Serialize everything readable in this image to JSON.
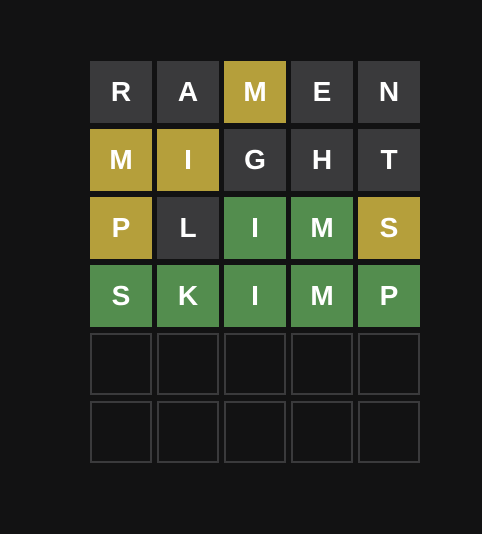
{
  "game": {
    "colors": {
      "background": "#121213",
      "absent": "#3a3a3c",
      "present": "#b59f3b",
      "correct": "#538d4e",
      "empty_border": "#3a3a3c",
      "letter": "#ffffff"
    },
    "rows": [
      {
        "word": "RAMEN",
        "tiles": [
          {
            "letter": "R",
            "state": "absent"
          },
          {
            "letter": "A",
            "state": "absent"
          },
          {
            "letter": "M",
            "state": "present"
          },
          {
            "letter": "E",
            "state": "absent"
          },
          {
            "letter": "N",
            "state": "absent"
          }
        ]
      },
      {
        "word": "MIGHT",
        "tiles": [
          {
            "letter": "M",
            "state": "present"
          },
          {
            "letter": "I",
            "state": "present"
          },
          {
            "letter": "G",
            "state": "absent"
          },
          {
            "letter": "H",
            "state": "absent"
          },
          {
            "letter": "T",
            "state": "absent"
          }
        ]
      },
      {
        "word": "PLIMS",
        "tiles": [
          {
            "letter": "P",
            "state": "present"
          },
          {
            "letter": "L",
            "state": "absent"
          },
          {
            "letter": "I",
            "state": "correct"
          },
          {
            "letter": "M",
            "state": "correct"
          },
          {
            "letter": "S",
            "state": "present"
          }
        ]
      },
      {
        "word": "SKIMP",
        "tiles": [
          {
            "letter": "S",
            "state": "correct"
          },
          {
            "letter": "K",
            "state": "correct"
          },
          {
            "letter": "I",
            "state": "correct"
          },
          {
            "letter": "M",
            "state": "correct"
          },
          {
            "letter": "P",
            "state": "correct"
          }
        ]
      },
      {
        "word": "",
        "tiles": [
          {
            "letter": "",
            "state": "empty"
          },
          {
            "letter": "",
            "state": "empty"
          },
          {
            "letter": "",
            "state": "empty"
          },
          {
            "letter": "",
            "state": "empty"
          },
          {
            "letter": "",
            "state": "empty"
          }
        ]
      },
      {
        "word": "",
        "tiles": [
          {
            "letter": "",
            "state": "empty"
          },
          {
            "letter": "",
            "state": "empty"
          },
          {
            "letter": "",
            "state": "empty"
          },
          {
            "letter": "",
            "state": "empty"
          },
          {
            "letter": "",
            "state": "empty"
          }
        ]
      }
    ]
  }
}
